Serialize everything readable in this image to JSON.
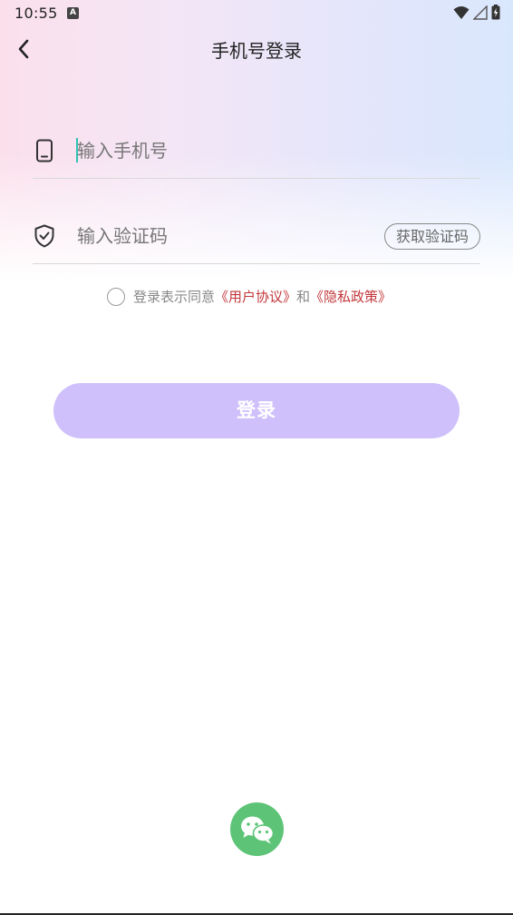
{
  "status_bar": {
    "time": "10:55",
    "notification_icon": "A",
    "icons": [
      "wifi-icon",
      "signal-icon",
      "battery-icon"
    ]
  },
  "header": {
    "title": "手机号登录",
    "back_icon": "chevron-left-icon"
  },
  "phone_field": {
    "icon": "phone-icon",
    "placeholder": "输入手机号",
    "value": ""
  },
  "code_field": {
    "icon": "shield-check-icon",
    "placeholder": "输入验证码",
    "value": "",
    "get_code_label": "获取验证码"
  },
  "agreement": {
    "checked": false,
    "prefix": "登录表示同意",
    "user_agreement": "《用户协议》",
    "and": "和",
    "privacy_policy": "《隐私政策》"
  },
  "login_button": {
    "label": "登录"
  },
  "wechat_login": {
    "icon": "wechat-icon"
  },
  "colors": {
    "accent": "#cfc0fb",
    "link": "#c2373b",
    "wechat": "#5dc477",
    "caret": "#2fc3b4"
  }
}
